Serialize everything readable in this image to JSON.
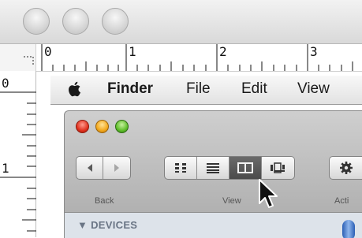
{
  "ruler": {
    "top_numbers": [
      "0",
      "1",
      "2",
      "3"
    ],
    "left_numbers": [
      "0",
      "1"
    ]
  },
  "menubar": {
    "finder": "Finder",
    "file": "File",
    "edit": "Edit",
    "view": "View"
  },
  "toolbar": {
    "back_label": "Back",
    "view_label": "View",
    "action_label": "Acti"
  },
  "view_modes": [
    "icon-view",
    "list-view",
    "column-view",
    "coverflow-view"
  ],
  "active_view_mode": "column-view",
  "sidebar": {
    "section": "DEVICES"
  },
  "colors": {
    "close": "#e0321f",
    "minimize": "#f2a81c",
    "zoom": "#5fbe2a",
    "active_segment": "#4a4a4a"
  }
}
